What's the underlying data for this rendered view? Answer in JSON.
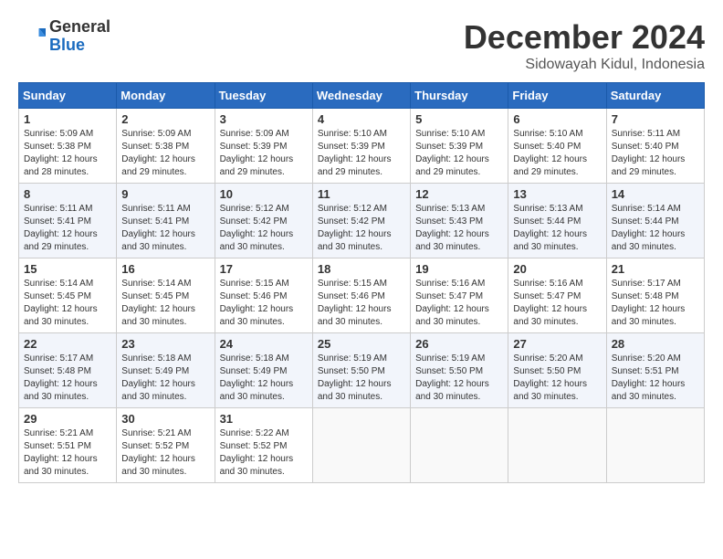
{
  "logo": {
    "general": "General",
    "blue": "Blue"
  },
  "header": {
    "month": "December 2024",
    "location": "Sidowayah Kidul, Indonesia"
  },
  "weekdays": [
    "Sunday",
    "Monday",
    "Tuesday",
    "Wednesday",
    "Thursday",
    "Friday",
    "Saturday"
  ],
  "weeks": [
    [
      {
        "day": "1",
        "sunrise": "5:09 AM",
        "sunset": "5:38 PM",
        "daylight": "12 hours and 28 minutes."
      },
      {
        "day": "2",
        "sunrise": "5:09 AM",
        "sunset": "5:38 PM",
        "daylight": "12 hours and 29 minutes."
      },
      {
        "day": "3",
        "sunrise": "5:09 AM",
        "sunset": "5:39 PM",
        "daylight": "12 hours and 29 minutes."
      },
      {
        "day": "4",
        "sunrise": "5:10 AM",
        "sunset": "5:39 PM",
        "daylight": "12 hours and 29 minutes."
      },
      {
        "day": "5",
        "sunrise": "5:10 AM",
        "sunset": "5:39 PM",
        "daylight": "12 hours and 29 minutes."
      },
      {
        "day": "6",
        "sunrise": "5:10 AM",
        "sunset": "5:40 PM",
        "daylight": "12 hours and 29 minutes."
      },
      {
        "day": "7",
        "sunrise": "5:11 AM",
        "sunset": "5:40 PM",
        "daylight": "12 hours and 29 minutes."
      }
    ],
    [
      {
        "day": "8",
        "sunrise": "5:11 AM",
        "sunset": "5:41 PM",
        "daylight": "12 hours and 29 minutes."
      },
      {
        "day": "9",
        "sunrise": "5:11 AM",
        "sunset": "5:41 PM",
        "daylight": "12 hours and 30 minutes."
      },
      {
        "day": "10",
        "sunrise": "5:12 AM",
        "sunset": "5:42 PM",
        "daylight": "12 hours and 30 minutes."
      },
      {
        "day": "11",
        "sunrise": "5:12 AM",
        "sunset": "5:42 PM",
        "daylight": "12 hours and 30 minutes."
      },
      {
        "day": "12",
        "sunrise": "5:13 AM",
        "sunset": "5:43 PM",
        "daylight": "12 hours and 30 minutes."
      },
      {
        "day": "13",
        "sunrise": "5:13 AM",
        "sunset": "5:44 PM",
        "daylight": "12 hours and 30 minutes."
      },
      {
        "day": "14",
        "sunrise": "5:14 AM",
        "sunset": "5:44 PM",
        "daylight": "12 hours and 30 minutes."
      }
    ],
    [
      {
        "day": "15",
        "sunrise": "5:14 AM",
        "sunset": "5:45 PM",
        "daylight": "12 hours and 30 minutes."
      },
      {
        "day": "16",
        "sunrise": "5:14 AM",
        "sunset": "5:45 PM",
        "daylight": "12 hours and 30 minutes."
      },
      {
        "day": "17",
        "sunrise": "5:15 AM",
        "sunset": "5:46 PM",
        "daylight": "12 hours and 30 minutes."
      },
      {
        "day": "18",
        "sunrise": "5:15 AM",
        "sunset": "5:46 PM",
        "daylight": "12 hours and 30 minutes."
      },
      {
        "day": "19",
        "sunrise": "5:16 AM",
        "sunset": "5:47 PM",
        "daylight": "12 hours and 30 minutes."
      },
      {
        "day": "20",
        "sunrise": "5:16 AM",
        "sunset": "5:47 PM",
        "daylight": "12 hours and 30 minutes."
      },
      {
        "day": "21",
        "sunrise": "5:17 AM",
        "sunset": "5:48 PM",
        "daylight": "12 hours and 30 minutes."
      }
    ],
    [
      {
        "day": "22",
        "sunrise": "5:17 AM",
        "sunset": "5:48 PM",
        "daylight": "12 hours and 30 minutes."
      },
      {
        "day": "23",
        "sunrise": "5:18 AM",
        "sunset": "5:49 PM",
        "daylight": "12 hours and 30 minutes."
      },
      {
        "day": "24",
        "sunrise": "5:18 AM",
        "sunset": "5:49 PM",
        "daylight": "12 hours and 30 minutes."
      },
      {
        "day": "25",
        "sunrise": "5:19 AM",
        "sunset": "5:50 PM",
        "daylight": "12 hours and 30 minutes."
      },
      {
        "day": "26",
        "sunrise": "5:19 AM",
        "sunset": "5:50 PM",
        "daylight": "12 hours and 30 minutes."
      },
      {
        "day": "27",
        "sunrise": "5:20 AM",
        "sunset": "5:50 PM",
        "daylight": "12 hours and 30 minutes."
      },
      {
        "day": "28",
        "sunrise": "5:20 AM",
        "sunset": "5:51 PM",
        "daylight": "12 hours and 30 minutes."
      }
    ],
    [
      {
        "day": "29",
        "sunrise": "5:21 AM",
        "sunset": "5:51 PM",
        "daylight": "12 hours and 30 minutes."
      },
      {
        "day": "30",
        "sunrise": "5:21 AM",
        "sunset": "5:52 PM",
        "daylight": "12 hours and 30 minutes."
      },
      {
        "day": "31",
        "sunrise": "5:22 AM",
        "sunset": "5:52 PM",
        "daylight": "12 hours and 30 minutes."
      },
      null,
      null,
      null,
      null
    ]
  ]
}
